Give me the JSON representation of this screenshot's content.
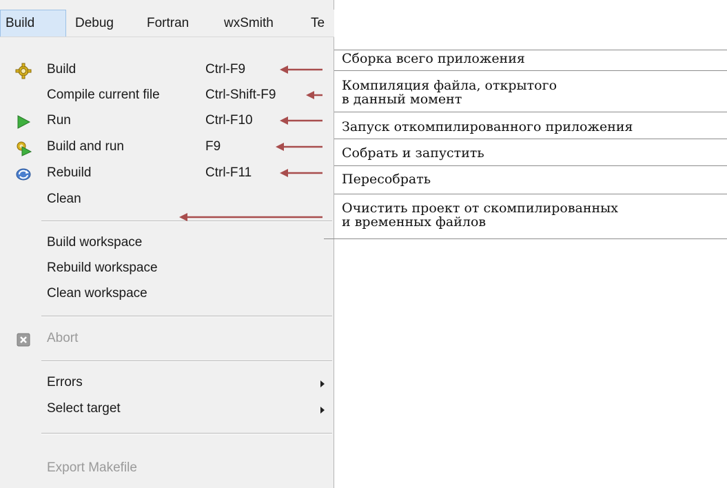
{
  "menubar": {
    "items": [
      {
        "label": "Build",
        "active": true
      },
      {
        "label": "Debug",
        "active": false
      },
      {
        "label": "Fortran",
        "active": false
      },
      {
        "label": "wxSmith",
        "active": false
      },
      {
        "label": "Te",
        "active": false
      }
    ]
  },
  "menu": {
    "items": [
      {
        "label": "Build",
        "shortcut": "Ctrl-F9",
        "icon": "build-gear-icon"
      },
      {
        "label": "Compile current file",
        "shortcut": "Ctrl-Shift-F9",
        "icon": ""
      },
      {
        "label": "Run",
        "shortcut": "Ctrl-F10",
        "icon": "run-play-icon"
      },
      {
        "label": "Build and run",
        "shortcut": "F9",
        "icon": "build-and-run-icon"
      },
      {
        "label": "Rebuild",
        "shortcut": "Ctrl-F11",
        "icon": "rebuild-icon"
      },
      {
        "label": "Clean",
        "shortcut": "",
        "icon": ""
      },
      {
        "label": "Build workspace",
        "shortcut": "",
        "icon": ""
      },
      {
        "label": "Rebuild workspace",
        "shortcut": "",
        "icon": ""
      },
      {
        "label": "Clean workspace",
        "shortcut": "",
        "icon": ""
      },
      {
        "label": "Abort",
        "shortcut": "",
        "icon": "abort-icon",
        "disabled": true
      },
      {
        "label": "Errors",
        "shortcut": "",
        "icon": "",
        "submenu": true
      },
      {
        "label": "Select target",
        "shortcut": "",
        "icon": "",
        "submenu": true
      },
      {
        "label": "Export Makefile",
        "shortcut": "",
        "icon": "",
        "disabled": true
      }
    ]
  },
  "descriptions": [
    {
      "lines": [
        "Сборка всего приложения"
      ]
    },
    {
      "lines": [
        "Компиляция файла, открытого",
        "в данный момент"
      ]
    },
    {
      "lines": [
        "Запуск откомпилированного приложения"
      ]
    },
    {
      "lines": [
        "Собрать и запустить"
      ]
    },
    {
      "lines": [
        "Пересобрать"
      ]
    },
    {
      "lines": [
        "Очистить проект от скомпилированных",
        "и временных файлов"
      ]
    }
  ],
  "colors": {
    "arrow": "#a84d4d",
    "menu_background": "#f0f0f0",
    "active_menubar": "#d7e7f8",
    "disabled_text": "#9a9a9a"
  }
}
